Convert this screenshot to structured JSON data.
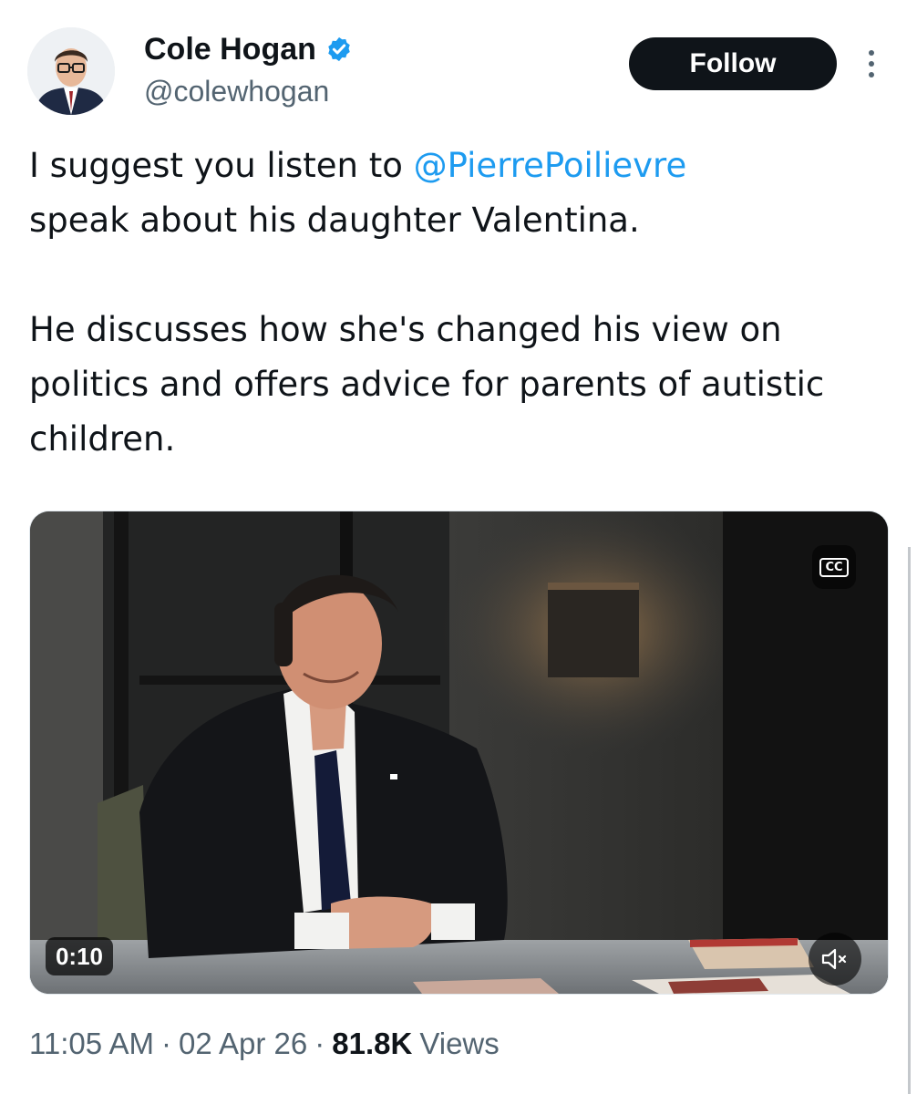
{
  "author": {
    "display_name": "Cole Hogan",
    "handle": "@colewhogan",
    "verified": true
  },
  "follow_label": "Follow",
  "tweet": {
    "line1_prefix": "I suggest you listen to ",
    "mention": "@PierrePoilievre",
    "line1_suffix": "speak about his daughter Valentina.",
    "paragraph2": "He discusses how she's changed his view on politics and offers advice for parents of autistic children."
  },
  "video": {
    "duration": "0:10",
    "cc_label": "CC",
    "muted": true
  },
  "meta": {
    "time": "11:05 AM",
    "separator": "·",
    "date": "02 Apr 26",
    "views_count": "81.8K",
    "views_label": "Views"
  },
  "colors": {
    "accent": "#1d9bf0",
    "text": "#0f1419",
    "secondary": "#536471",
    "follow_bg": "#0f1419"
  },
  "icons": [
    "verified-badge-icon",
    "more-options-icon",
    "closed-captions-icon",
    "mute-icon"
  ]
}
